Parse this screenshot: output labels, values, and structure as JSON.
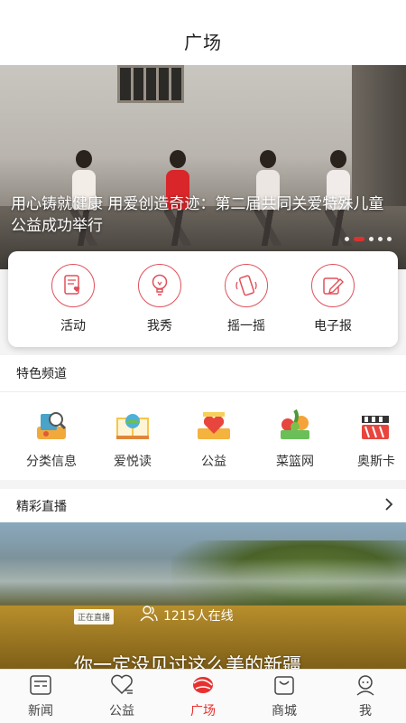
{
  "header": {
    "title": "广场"
  },
  "banner": {
    "caption": "用心铸就健康 用爱创造奇迹：第二届共同关爱特殊儿童公益成功举行",
    "slide_count": 5,
    "active_slide": 2
  },
  "quick_actions": [
    {
      "label": "活动",
      "icon": "document-heart-icon"
    },
    {
      "label": "我秀",
      "icon": "lightbulb-icon"
    },
    {
      "label": "摇一摇",
      "icon": "phone-shake-icon"
    },
    {
      "label": "电子报",
      "icon": "pencil-note-icon"
    }
  ],
  "features": {
    "title": "特色频道",
    "items": [
      {
        "label": "分类信息",
        "icon": "classifieds-icon"
      },
      {
        "label": "爱悦读",
        "icon": "reading-icon"
      },
      {
        "label": "公益",
        "icon": "charity-heart-icon"
      },
      {
        "label": "菜篮网",
        "icon": "vegetable-basket-icon"
      },
      {
        "label": "奥斯卡",
        "icon": "movie-icon"
      }
    ]
  },
  "live": {
    "title": "精彩直播",
    "badge": "正在直播",
    "online": "1215人在线",
    "stream_title": "你一定没见过这么美的新疆"
  },
  "tabs": [
    {
      "label": "新闻",
      "icon": "news-icon",
      "active": false
    },
    {
      "label": "公益",
      "icon": "heart-icon",
      "active": false
    },
    {
      "label": "广场",
      "icon": "plaza-icon",
      "active": true
    },
    {
      "label": "商城",
      "icon": "shopping-bag-icon",
      "active": false
    },
    {
      "label": "我",
      "icon": "profile-icon",
      "active": false
    }
  ],
  "colors": {
    "accent": "#e8312f",
    "icon_outline": "#e0505a"
  }
}
